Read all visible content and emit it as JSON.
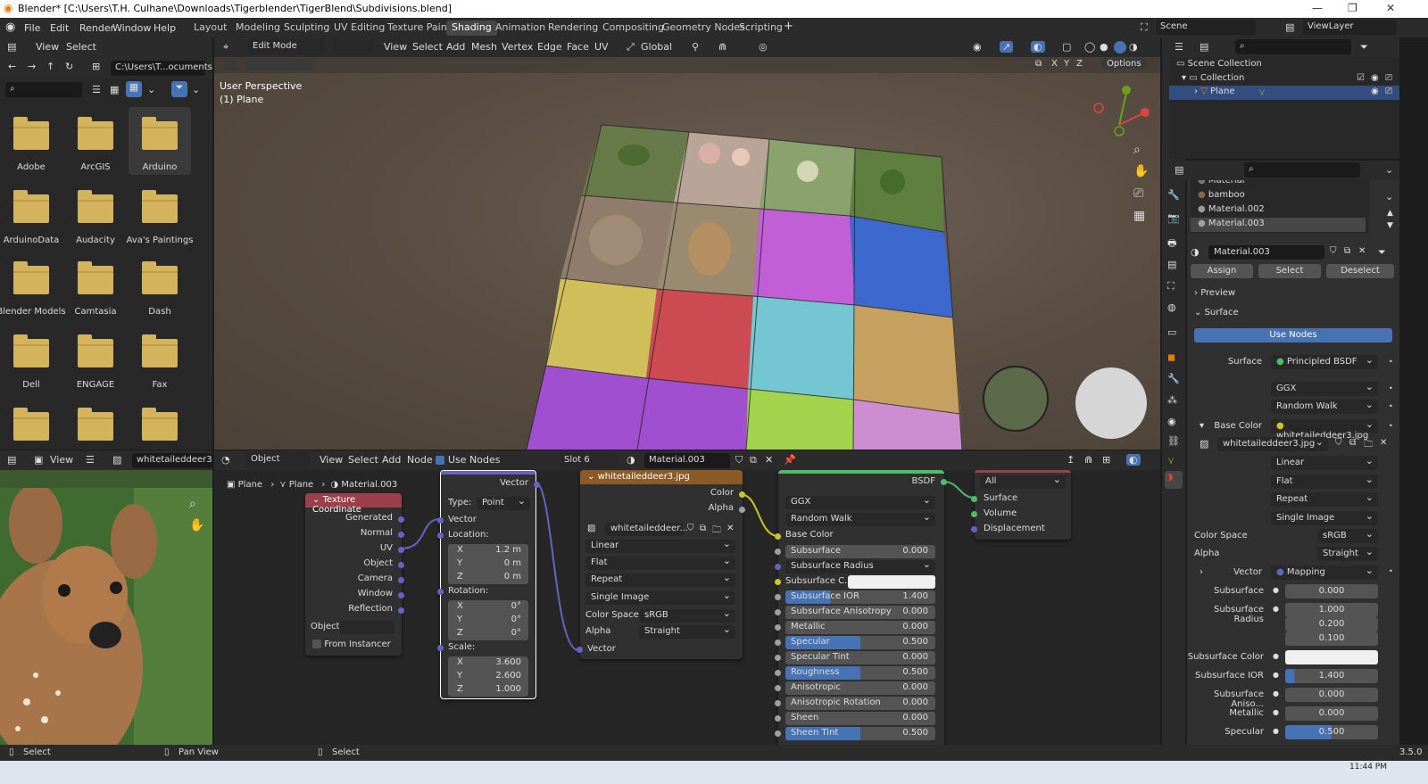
{
  "window": {
    "title": "Blender* [C:\\Users\\T.H. Culhane\\Downloads\\Tigerblender\\TigerBlend\\Subdivisions.blend]"
  },
  "menu": {
    "items": [
      "File",
      "Edit",
      "Render",
      "Window",
      "Help"
    ]
  },
  "workspaces": [
    "Layout",
    "Modeling",
    "Sculpting",
    "UV Editing",
    "Texture Paint",
    "Shading",
    "Animation",
    "Rendering",
    "Compositing",
    "Geometry Nodes",
    "Scripting"
  ],
  "scene": {
    "name": "Scene",
    "view_layer": "ViewLayer"
  },
  "filebrowser": {
    "view": "View",
    "select": "Select",
    "path": "C:\\Users\\T...ocuments\\",
    "folders": [
      "Adobe",
      "ArcGIS",
      "Arduino",
      "ArduinoData",
      "Audacity",
      "Ava's Paintings",
      "Blender Models",
      "Camtasia",
      "Dash",
      "Dell",
      "ENGAGE",
      "Fax",
      "",
      "",
      ""
    ]
  },
  "viewport": {
    "mode": "Edit Mode",
    "menus": [
      "View",
      "Select",
      "Add",
      "Mesh",
      "Vertex",
      "Edge",
      "Face",
      "UV"
    ],
    "orientation": "Global",
    "info1": "User Perspective",
    "info2": "(1) Plane",
    "options": "Options",
    "axes": [
      "X",
      "Y",
      "Z"
    ],
    "colors": {
      "purple": "#a04fd0",
      "magenta": "#c25ed6",
      "blue": "#3d69cf",
      "yellow": "#cfbe5a",
      "red": "#cc4b53",
      "cyan": "#74c7d2",
      "gold": "#c6a05e",
      "lime": "#a3d24d",
      "pink": "#cd8ed1"
    }
  },
  "image_editor": {
    "view": "View",
    "image": "whitetaileddeer3.jpg"
  },
  "node_editor": {
    "object": "Object",
    "menus": [
      "View",
      "Select",
      "Add",
      "Node"
    ],
    "use_nodes": "Use Nodes",
    "slot": "Slot 6",
    "material": "Material.003",
    "breadcrumb": [
      "Plane",
      "Plane",
      "Material.003"
    ],
    "texcoord": {
      "title": "Texture Coordinate",
      "outputs": [
        "Generated",
        "Normal",
        "UV",
        "Object",
        "Camera",
        "Window",
        "Reflection"
      ],
      "object_label": "Object:",
      "from_instancer": "From Instancer"
    },
    "mapping": {
      "output": "Vector",
      "type_label": "Type:",
      "type": "Point",
      "vector": "Vector",
      "location": "Location:",
      "rotation": "Rotation:",
      "scale": "Scale:",
      "loc": [
        "1.2 m",
        "0 m",
        "0 m"
      ],
      "rot": [
        "0°",
        "0°",
        "0°"
      ],
      "scl": [
        "3.600",
        "2.600",
        "1.000"
      ],
      "axes": [
        "X",
        "Y",
        "Z"
      ]
    },
    "imagetex": {
      "title": "whitetaileddeer3.jpg",
      "outputs": [
        "Color",
        "Alpha"
      ],
      "image": "whitetaileddeer...",
      "interp": "Linear",
      "proj": "Flat",
      "ext": "Repeat",
      "src": "Single Image",
      "cs_label": "Color Space",
      "cs": "sRGB",
      "alpha_label": "Alpha",
      "alpha": "Straight",
      "vector": "Vector"
    },
    "bsdf": {
      "output": "BSDF",
      "dist": "GGX",
      "ss_method": "Random Walk",
      "base_color": "Base Color",
      "rows": [
        {
          "label": "Subsurface",
          "value": "0.000",
          "fill": 0
        },
        {
          "label": "Subsurface Radius",
          "value": "",
          "fill": -1
        },
        {
          "label": "Subsurface C...",
          "value": "",
          "fill": -2
        },
        {
          "label": "Subsurface IOR",
          "value": "1.400",
          "fill": 0.3
        },
        {
          "label": "Subsurface Anisotropy",
          "value": "0.000",
          "fill": 0
        },
        {
          "label": "Metallic",
          "value": "0.000",
          "fill": 0
        },
        {
          "label": "Specular",
          "value": "0.500",
          "fill": 0.5
        },
        {
          "label": "Specular Tint",
          "value": "0.000",
          "fill": 0
        },
        {
          "label": "Roughness",
          "value": "0.500",
          "fill": 0.5
        },
        {
          "label": "Anisotropic",
          "value": "0.000",
          "fill": 0
        },
        {
          "label": "Anisotropic Rotation",
          "value": "0.000",
          "fill": 0
        },
        {
          "label": "Sheen",
          "value": "0.000",
          "fill": 0
        },
        {
          "label": "Sheen Tint",
          "value": "0.500",
          "fill": 0.5
        }
      ]
    },
    "output": {
      "target": "All",
      "inputs": [
        "Surface",
        "Volume",
        "Displacement"
      ]
    }
  },
  "outliner": {
    "scene_collection": "Scene Collection",
    "collection": "Collection",
    "plane": "Plane"
  },
  "properties": {
    "materials": [
      "Material",
      "bamboo",
      "Material.002",
      "Material.003"
    ],
    "material": "Material.003",
    "assign": "Assign",
    "select": "Select",
    "deselect": "Deselect",
    "preview": "Preview",
    "surface_panel": "Surface",
    "use_nodes": "Use Nodes",
    "surface_label": "Surface",
    "surface": "Principled BSDF",
    "dist": "GGX",
    "ss_method": "Random Walk",
    "base_color_label": "Base Color",
    "base_color": "whitetaileddeer3.jpg",
    "image": "whitetaileddeer3.jpg",
    "interp": "Linear",
    "proj": "Flat",
    "ext": "Repeat",
    "src": "Single Image",
    "cs_label": "Color Space",
    "cs": "sRGB",
    "alpha_label": "Alpha",
    "alpha": "Straight",
    "vector_label": "Vector",
    "vector": "Mapping",
    "ss_label": "Subsurface",
    "ss": "0.000",
    "ssr_label": "Subsurface Radius",
    "ssr": [
      "1.000",
      "0.200",
      "0.100"
    ],
    "ssc_label": "Subsurface Color",
    "ssior_label": "Subsurface IOR",
    "ssior": "1.400",
    "ssan_label": "Subsurface Aniso...",
    "ssan": "0.000",
    "metallic_label": "Metallic",
    "metallic": "0.000",
    "specular_label": "Specular",
    "specular": "0.500"
  },
  "status": {
    "left": "Select",
    "mid": "Pan View",
    "right": "Select",
    "version": "3.5.0"
  },
  "taskbar": {
    "time": "11:44 PM"
  }
}
